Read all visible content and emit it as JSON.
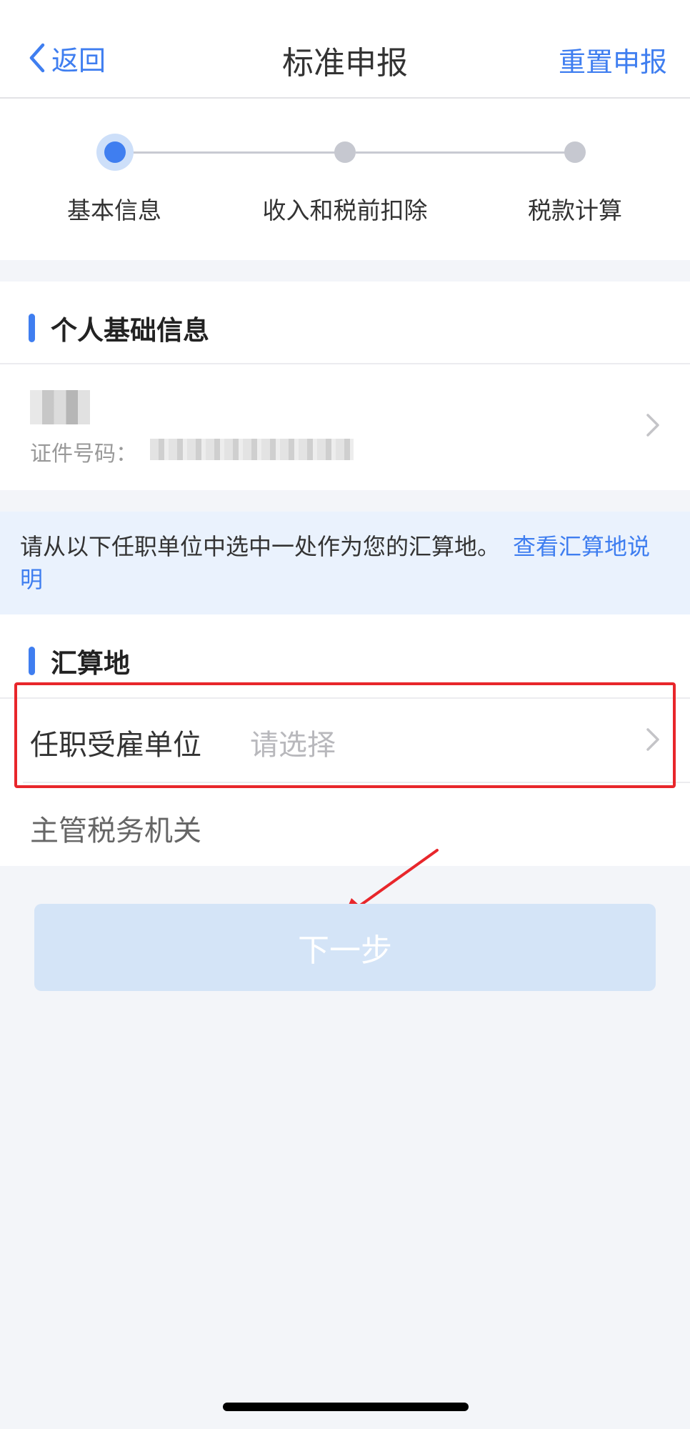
{
  "nav": {
    "back_label": "返回",
    "title": "标准申报",
    "reset_label": "重置申报"
  },
  "steps": [
    {
      "label": "基本信息",
      "active": true
    },
    {
      "label": "收入和税前扣除",
      "active": false
    },
    {
      "label": "税款计算",
      "active": false
    }
  ],
  "personal": {
    "section_title": "个人基础信息",
    "id_label": "证件号码："
  },
  "notice": {
    "text": "请从以下任职单位中选中一处作为您的汇算地。",
    "link": "查看汇算地说明"
  },
  "settlement": {
    "section_title": "汇算地",
    "employer_label": "任职受雇单位",
    "employer_placeholder": "请选择",
    "tax_authority_label": "主管税务机关"
  },
  "next_button": "下一步",
  "colors": {
    "accent": "#3f7ef0",
    "highlight": "#e8262b",
    "button_disabled": "#d4e4f7"
  }
}
